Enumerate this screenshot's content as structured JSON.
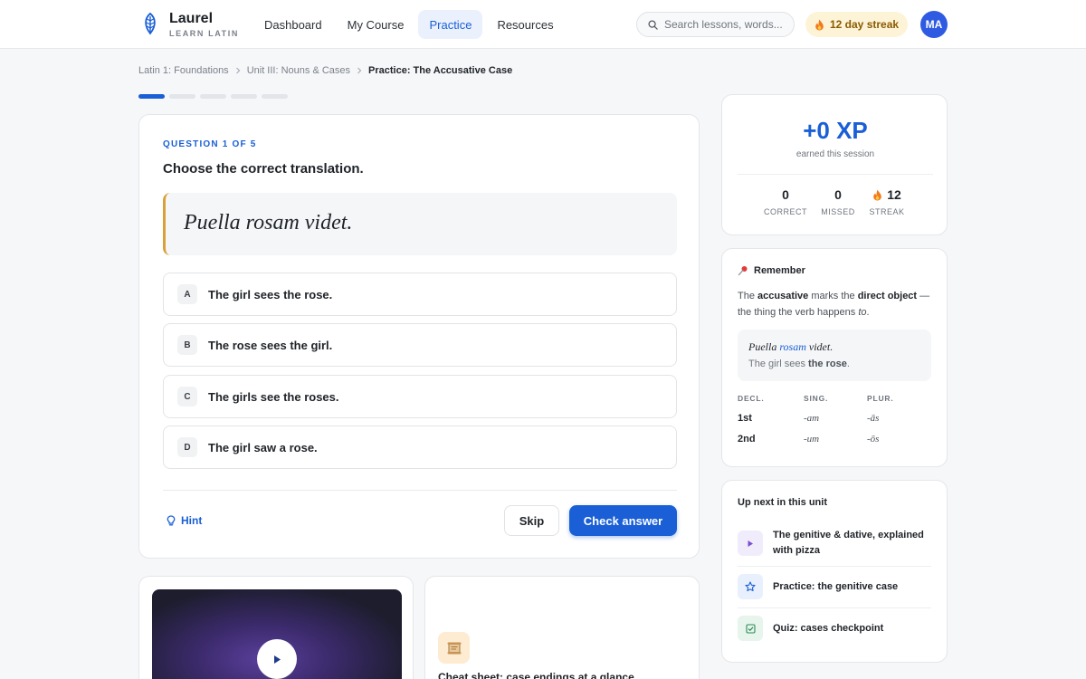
{
  "app": {
    "name": "Laurel",
    "tagline": "LEARN LATIN"
  },
  "nav": {
    "items": [
      {
        "label": "Dashboard",
        "active": false
      },
      {
        "label": "My Course",
        "active": false
      },
      {
        "label": "Practice",
        "active": true
      },
      {
        "label": "Resources",
        "active": false
      }
    ]
  },
  "search": {
    "placeholder": "Search lessons, words..."
  },
  "streak_badge": {
    "label": "12 day streak",
    "icon": "flame-icon"
  },
  "user": {
    "initials": "MA",
    "color": "#2f5be3"
  },
  "breadcrumb": {
    "items": [
      "Latin 1: Foundations",
      "Unit III: Nouns & Cases",
      "Practice: The Accusative Case"
    ]
  },
  "progress": {
    "current": 1,
    "total": 5
  },
  "question": {
    "label": "QUESTION 1 OF 5",
    "prompt": "Choose the correct translation.",
    "latin": "Puella rosam videt.",
    "options": [
      {
        "key": "A",
        "text": "The girl sees the rose."
      },
      {
        "key": "B",
        "text": "The rose sees the girl."
      },
      {
        "key": "C",
        "text": "The girls see the roses."
      },
      {
        "key": "D",
        "text": "The girl saw a rose."
      }
    ],
    "hint_label": "Hint",
    "skip_label": "Skip",
    "check_label": "Check answer"
  },
  "video_card": {
    "icon": "play-icon"
  },
  "cheat_sheet": {
    "title": "Cheat sheet: case endings at a glance",
    "icon": "scroll-icon"
  },
  "session": {
    "xp": "+0 XP",
    "xp_sub": "earned this session",
    "stats": [
      {
        "value": "0",
        "label": "CORRECT"
      },
      {
        "value": "0",
        "label": "MISSED"
      },
      {
        "value": "12",
        "label": "STREAK"
      }
    ]
  },
  "remember": {
    "title": "Remember",
    "icon": "pin-icon",
    "body_parts": [
      "The ",
      "accusative",
      " marks the ",
      "direct object",
      " — the thing the verb happens ",
      "to",
      "."
    ],
    "example_latin": [
      "Puella ",
      "rosam",
      " videt."
    ],
    "example_english": [
      "The girl sees ",
      "the rose",
      "."
    ],
    "table": {
      "headers": [
        "DECL.",
        "SING.",
        "PLUR."
      ],
      "rows": [
        [
          "1st",
          "-am",
          "-ās"
        ],
        [
          "2nd",
          "-um",
          "-ōs"
        ]
      ]
    }
  },
  "up_next": {
    "title": "Up next in this unit",
    "items": [
      {
        "label": "The genitive & dative, explained with pizza",
        "icon": "play-icon",
        "bg": "#f1ecfb",
        "fg": "#7b4fd0"
      },
      {
        "label": "Practice: the genitive case",
        "icon": "star-icon",
        "bg": "#e9f0fd",
        "fg": "#1a5fd6"
      },
      {
        "label": "Quiz: cases checkpoint",
        "icon": "checkbox-icon",
        "bg": "#e7f5ec",
        "fg": "#2e8b57"
      }
    ]
  },
  "colors": {
    "accent": "#1a5fd6",
    "latin_border": "#d9a13a",
    "streak_bg": "#fdf3d7"
  }
}
